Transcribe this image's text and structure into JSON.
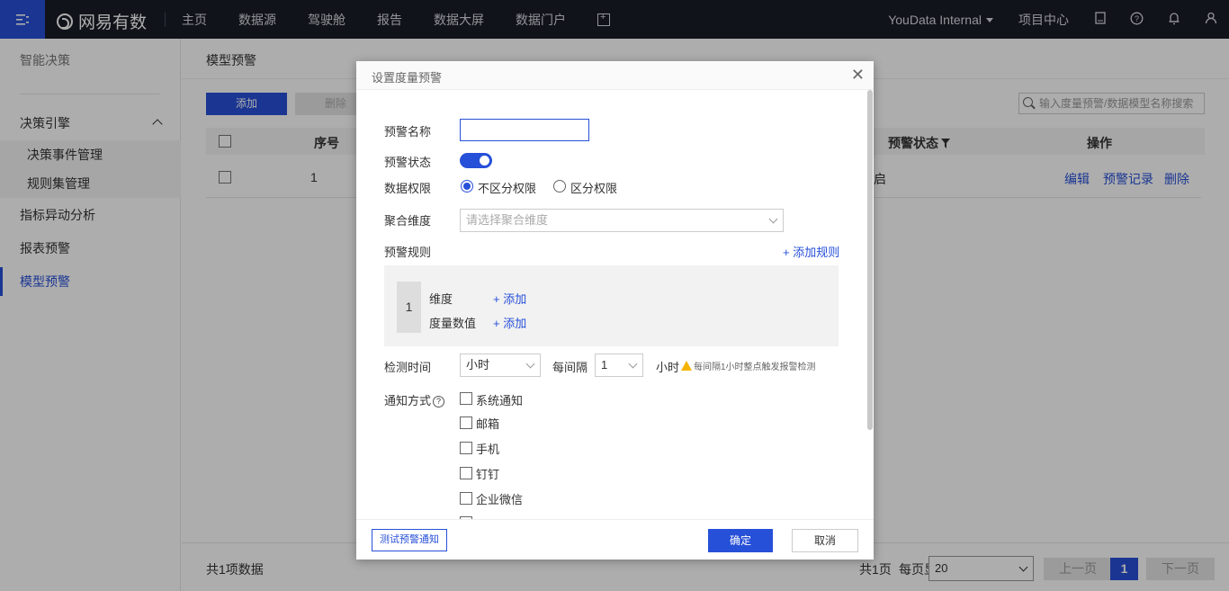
{
  "topbar": {
    "brand": "网易有数",
    "nav": [
      "主页",
      "数据源",
      "驾驶舱",
      "报告",
      "数据大屏",
      "数据门户"
    ],
    "workspace": "YouData Internal",
    "project_center": "项目中心",
    "accent": "#2750d8"
  },
  "sidebar": {
    "title": "智能决策",
    "group": "决策引擎",
    "sub_items": [
      "决策事件管理",
      "规则集管理"
    ],
    "items": [
      "指标异动分析",
      "报表预警",
      "模型预警"
    ],
    "active": "模型预警"
  },
  "main": {
    "page_title": "模型预警",
    "add_label": "添加",
    "delete_label": "删除",
    "search_placeholder": "输入度量预警/数据模型名称搜索",
    "columns": {
      "index": "序号",
      "status": "预警状态",
      "actions": "操作"
    },
    "row": {
      "index": "1",
      "status_fragment": "启",
      "edit": "编辑",
      "records": "预警记录",
      "delete": "删除"
    },
    "footer": {
      "total": "共1项数据",
      "pages": "共1页",
      "per_page_label": "每页显示",
      "per_page": "20",
      "prev": "上一页",
      "current": "1",
      "next": "下一页"
    }
  },
  "modal": {
    "title": "设置度量预警",
    "name_label": "预警名称",
    "name_value": "",
    "status_label": "预警状态",
    "permission_label": "数据权限",
    "permission_opt1": "不区分权限",
    "permission_opt2": "区分权限",
    "agg_label": "聚合维度",
    "agg_placeholder": "请选择聚合维度",
    "rules_label": "预警规则",
    "add_rule": "+ 添加规则",
    "rule": {
      "num": "1",
      "dim_label": "维度",
      "measure_label": "度量数值",
      "add": "+ 添加"
    },
    "detect_label": "检测时间",
    "detect_unit": "小时",
    "every_label": "每间隔",
    "every_value": "1",
    "every_unit": "小时",
    "warn_text": "每间隔1小时整点触发报警检测",
    "notify_label": "通知方式",
    "notify_options": [
      "系统通知",
      "邮箱",
      "手机",
      "钉钉",
      "企业微信"
    ],
    "test_button": "测试预警通知",
    "ok_button": "确定",
    "cancel_button": "取消"
  }
}
